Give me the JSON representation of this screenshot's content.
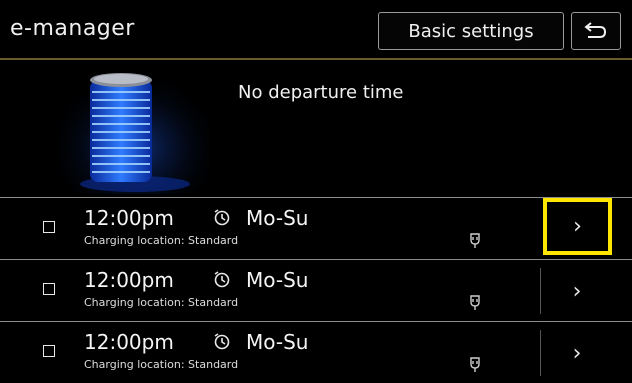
{
  "header": {
    "title": "e-manager",
    "basic_settings_label": "Basic settings",
    "back_icon": "back-arrow-icon"
  },
  "status_text": "No departure time",
  "timers": [
    {
      "time": "12:00pm",
      "days": "Mo-Su",
      "location": "Charging location: Standard",
      "highlighted": true
    },
    {
      "time": "12:00pm",
      "days": "Mo-Su",
      "location": "Charging location: Standard",
      "highlighted": false
    },
    {
      "time": "12:00pm",
      "days": "Mo-Su",
      "location": "Charging location: Standard",
      "highlighted": false
    }
  ],
  "arrow_glyph": "›",
  "colors": {
    "highlight": "#ffe600",
    "battery_glow": "#1e6bff",
    "header_rule": "#6b5a2e"
  }
}
